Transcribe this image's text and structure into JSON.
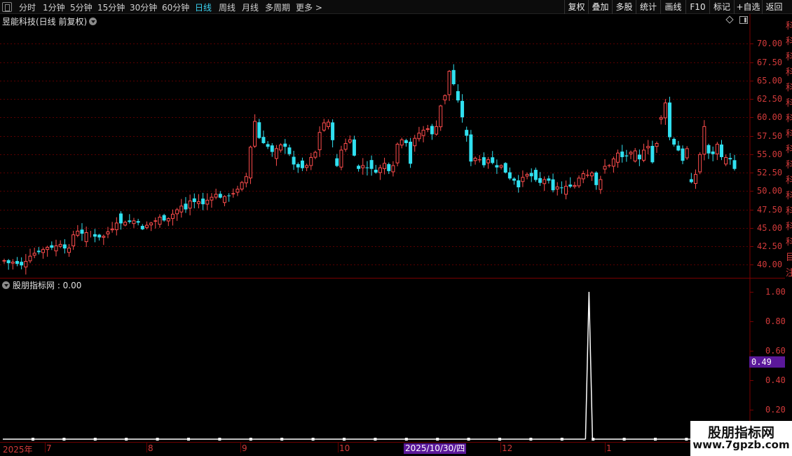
{
  "toolbar": {
    "periods": [
      "分时",
      "1分钟",
      "5分钟",
      "15分钟",
      "30分钟",
      "60分钟",
      "日线",
      "周线",
      "月线",
      "多周期",
      "更多 >"
    ],
    "active_period": "日线",
    "right_buttons": [
      "复权",
      "叠加",
      "多股",
      "统计",
      "画线",
      "F10",
      "标记",
      "+自选",
      "返回"
    ]
  },
  "main_chart": {
    "title": "昱能科技(日线 前复权)",
    "price_labels": [
      "70.00",
      "67.50",
      "65.00",
      "62.50",
      "60.00",
      "57.50",
      "55.00",
      "52.50",
      "50.00",
      "47.50",
      "45.00",
      "42.50",
      "40.00"
    ]
  },
  "indicator": {
    "title": "股朋指标网 : 0.00",
    "axis_labels": [
      "1.00",
      "0.80",
      "0.60",
      "0.40",
      "0.20"
    ],
    "cursor_value": "0.49",
    "signal_x_frac": 0.812
  },
  "date_axis": {
    "labels": [
      "2025年",
      "7",
      "8",
      "9",
      "10",
      "12",
      "1"
    ],
    "cursor_date": "2025/10/30/四"
  },
  "right_strip_chars": [
    "科",
    "科",
    "科",
    "科",
    "科",
    "科",
    "科",
    "科",
    "科",
    "科",
    "科",
    "科",
    "科",
    "科",
    "科",
    "目",
    "注"
  ],
  "watermark": {
    "title": "股朋指标网",
    "url": "www.7gpzb.com"
  },
  "colors": {
    "up": "#ff4d4d",
    "down": "#30e0f0",
    "axis_red": "#d23a3a",
    "accent": "#5a189a",
    "grid": "#5a0000"
  },
  "chart_data": {
    "type": "candlestick",
    "title": "昱能科技(日线 前复权)",
    "ylim": [
      38.5,
      72.5
    ],
    "series": [
      {
        "name": "close",
        "values": [
          40.6,
          40.2,
          40.4,
          40.1,
          39.9,
          40.5,
          41.2,
          41.6,
          41.7,
          42.1,
          42.4,
          42.3,
          42.6,
          42.8,
          42.2,
          42.3,
          44.1,
          44.6,
          44.2,
          44.4,
          44.2,
          43.8,
          43.7,
          43.9,
          44.5,
          44.9,
          45.7,
          45.6,
          45.8,
          45.8,
          46.0,
          45.7,
          44.8,
          45.4,
          45.7,
          46.0,
          46.5,
          46.0,
          46.3,
          46.9,
          47.5,
          48.0,
          47.5,
          48.7,
          48.5,
          48.6,
          48.2,
          48.8,
          49.2,
          49.6,
          49.1,
          49.3,
          49.3,
          49.7,
          50.3,
          51.2,
          52.0,
          56.0,
          59.5,
          57.2,
          56.5,
          56.0,
          55.3,
          55.8,
          56.3,
          56.0,
          55.0,
          53.6,
          53.2,
          53.1,
          53.5,
          54.6,
          55.3,
          58.0,
          59.3,
          59.4,
          56.9,
          53.4,
          55.6,
          56.5,
          57.0,
          54.8,
          53.0,
          53.5,
          53.1,
          53.0,
          52.5,
          53.2,
          53.8,
          52.7,
          53.5,
          56.4,
          57.0,
          56.5,
          53.7,
          57.2,
          57.9,
          58.3,
          58.5,
          57.7,
          58.8,
          61.6,
          63.0,
          66.3,
          64.5,
          62.3,
          60.0,
          57.5,
          54.0,
          54.5,
          54.3,
          53.5,
          54.3,
          53.8,
          53.2,
          53.5,
          52.5,
          51.7,
          51.4,
          50.5,
          51.9,
          52.3,
          52.0,
          51.5,
          51.1,
          51.6,
          51.4,
          50.1,
          50.6,
          50.4,
          50.7,
          50.6,
          50.8,
          51.8,
          52.4,
          52.2,
          52.5,
          50.8,
          51.6,
          53.4,
          53.5,
          54.4,
          55.2,
          54.6,
          54.7,
          55.3,
          55.5,
          54.3,
          55.6,
          56.1,
          53.9,
          56.5,
          60.0,
          62.0,
          57.3,
          56.3,
          55.5,
          54.1,
          55.8,
          51.2,
          52.3,
          55.0,
          58.8,
          55.1,
          55.0,
          56.4,
          54.6,
          54.6,
          54.3,
          53.0
        ]
      }
    ],
    "indicator_series": {
      "name": "股朋指标网",
      "signal_index": 135,
      "signal_value": 1.0,
      "baseline": 0.0
    }
  }
}
